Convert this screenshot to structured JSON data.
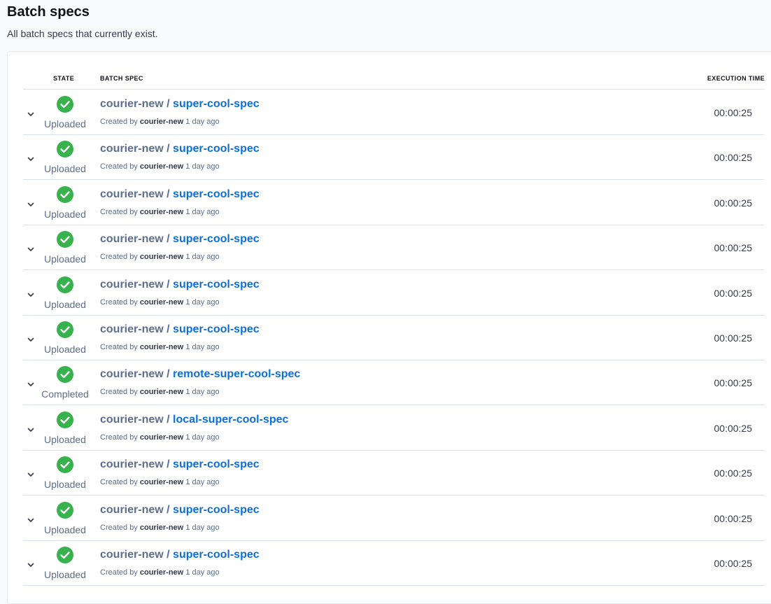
{
  "page": {
    "title": "Batch specs",
    "subtitle": "All batch specs that currently exist."
  },
  "table": {
    "headers": {
      "state": "STATE",
      "batch_spec": "BATCH SPEC",
      "execution_time": "EXECUTION TIME"
    },
    "rows": [
      {
        "state": "Uploaded",
        "namespace": "courier-new",
        "separator": "/",
        "name": "super-cool-spec",
        "created_prefix": "Created by",
        "creator": "courier-new",
        "created_ago": "1 day ago",
        "execution_time": "00:00:25"
      },
      {
        "state": "Uploaded",
        "namespace": "courier-new",
        "separator": "/",
        "name": "super-cool-spec",
        "created_prefix": "Created by",
        "creator": "courier-new",
        "created_ago": "1 day ago",
        "execution_time": "00:00:25"
      },
      {
        "state": "Uploaded",
        "namespace": "courier-new",
        "separator": "/",
        "name": "super-cool-spec",
        "created_prefix": "Created by",
        "creator": "courier-new",
        "created_ago": "1 day ago",
        "execution_time": "00:00:25"
      },
      {
        "state": "Uploaded",
        "namespace": "courier-new",
        "separator": "/",
        "name": "super-cool-spec",
        "created_prefix": "Created by",
        "creator": "courier-new",
        "created_ago": "1 day ago",
        "execution_time": "00:00:25"
      },
      {
        "state": "Uploaded",
        "namespace": "courier-new",
        "separator": "/",
        "name": "super-cool-spec",
        "created_prefix": "Created by",
        "creator": "courier-new",
        "created_ago": "1 day ago",
        "execution_time": "00:00:25"
      },
      {
        "state": "Uploaded",
        "namespace": "courier-new",
        "separator": "/",
        "name": "super-cool-spec",
        "created_prefix": "Created by",
        "creator": "courier-new",
        "created_ago": "1 day ago",
        "execution_time": "00:00:25"
      },
      {
        "state": "Completed",
        "namespace": "courier-new",
        "separator": "/",
        "name": "remote-super-cool-spec",
        "created_prefix": "Created by",
        "creator": "courier-new",
        "created_ago": "1 day ago",
        "execution_time": "00:00:25"
      },
      {
        "state": "Uploaded",
        "namespace": "courier-new",
        "separator": "/",
        "name": "local-super-cool-spec",
        "created_prefix": "Created by",
        "creator": "courier-new",
        "created_ago": "1 day ago",
        "execution_time": "00:00:25"
      },
      {
        "state": "Uploaded",
        "namespace": "courier-new",
        "separator": "/",
        "name": "super-cool-spec",
        "created_prefix": "Created by",
        "creator": "courier-new",
        "created_ago": "1 day ago",
        "execution_time": "00:00:25"
      },
      {
        "state": "Uploaded",
        "namespace": "courier-new",
        "separator": "/",
        "name": "super-cool-spec",
        "created_prefix": "Created by",
        "creator": "courier-new",
        "created_ago": "1 day ago",
        "execution_time": "00:00:25"
      },
      {
        "state": "Uploaded",
        "namespace": "courier-new",
        "separator": "/",
        "name": "super-cool-spec",
        "created_prefix": "Created by",
        "creator": "courier-new",
        "created_ago": "1 day ago",
        "execution_time": "00:00:25"
      }
    ]
  },
  "icons": {
    "state": "check-circle-icon",
    "expand": "chevron-down-icon"
  },
  "colors": {
    "success": "#37b24d",
    "link": "#0b70db",
    "muted": "#5e6e8c"
  }
}
